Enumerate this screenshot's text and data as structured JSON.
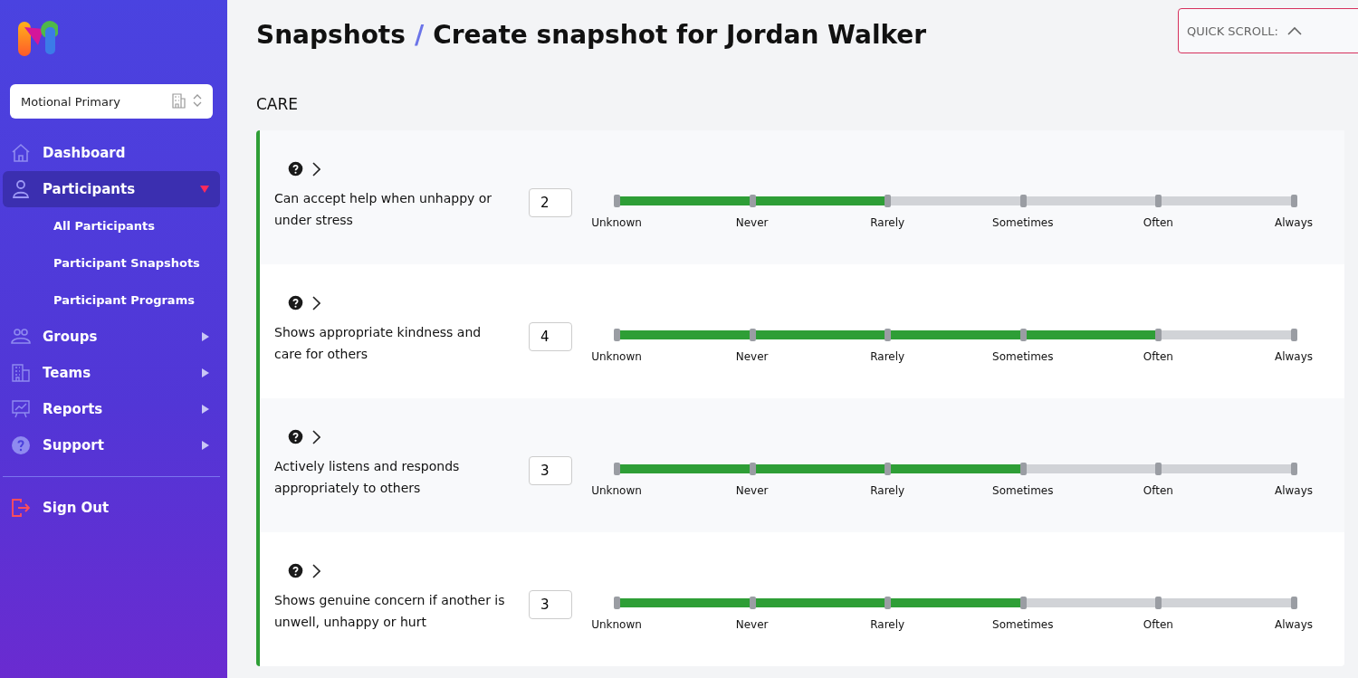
{
  "sidebar": {
    "organization": "Motional Primary",
    "items": [
      {
        "label": "Dashboard",
        "kind": "home",
        "selected": false
      },
      {
        "label": "Participants",
        "kind": "person",
        "selected": true,
        "expanded": true,
        "children": [
          {
            "label": "All Participants"
          },
          {
            "label": "Participant Snapshots"
          },
          {
            "label": "Participant Programs"
          }
        ]
      },
      {
        "label": "Groups",
        "kind": "group",
        "selected": false,
        "expanded": false
      },
      {
        "label": "Teams",
        "kind": "building",
        "selected": false,
        "expanded": false
      },
      {
        "label": "Reports",
        "kind": "chart",
        "selected": false,
        "expanded": false
      },
      {
        "label": "Support",
        "kind": "help",
        "selected": false,
        "expanded": false
      }
    ],
    "sign_out": "Sign Out"
  },
  "header": {
    "breadcrumb": "Snapshots",
    "separator": "/",
    "title": "Create snapshot for Jordan Walker"
  },
  "quick_scroll": {
    "label": "QUICK SCROLL:"
  },
  "section": {
    "title": "CARE",
    "questions": [
      {
        "text": "Can accept help when unhappy or under stress",
        "value": "2",
        "level": 0.4,
        "scale": [
          "Unknown",
          "Never",
          "Rarely",
          "Sometimes",
          "Often",
          "Always"
        ]
      },
      {
        "text": "Shows appropriate kindness and care for others",
        "value": "4",
        "level": 0.8,
        "scale": [
          "Unknown",
          "Never",
          "Rarely",
          "Sometimes",
          "Often",
          "Always"
        ]
      },
      {
        "text": "Actively listens and responds appropriately to others",
        "value": "3",
        "level": 0.6,
        "scale": [
          "Unknown",
          "Never",
          "Rarely",
          "Sometimes",
          "Often",
          "Always"
        ]
      },
      {
        "text": "Shows genuine concern if another is unwell, unhappy or hurt",
        "value": "3",
        "level": 0.6,
        "scale": [
          "Unknown",
          "Never",
          "Rarely",
          "Sometimes",
          "Often",
          "Always"
        ]
      }
    ]
  }
}
